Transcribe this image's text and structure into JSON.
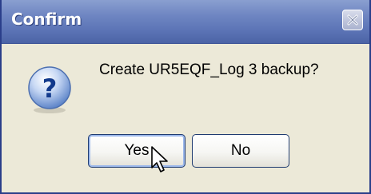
{
  "window": {
    "title": "Confirm",
    "close_icon": "close-icon"
  },
  "dialog": {
    "icon": "question-icon",
    "message": "Create UR5EQF_Log 3 backup?"
  },
  "buttons": {
    "yes_label": "Yes",
    "no_label": "No"
  },
  "colors": {
    "titlebar": "#6f86c2",
    "body": "#ece9d8",
    "border": "#2a3e8a"
  }
}
